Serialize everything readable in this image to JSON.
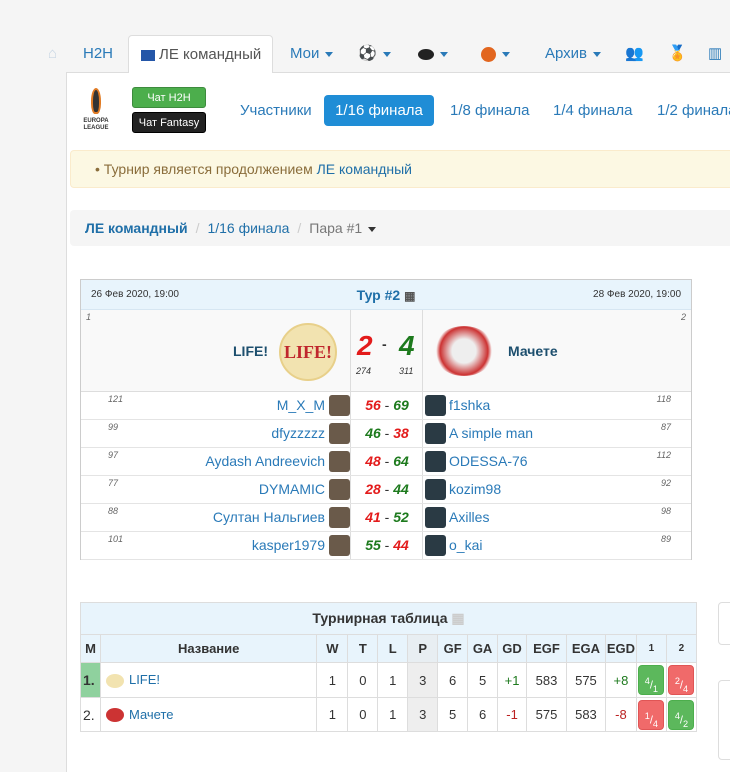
{
  "nav": {
    "tabs": [
      "H2H",
      "ЛЕ командный",
      "Мои",
      "Архив"
    ],
    "active": "ЛЕ командный"
  },
  "chat": {
    "h2h": "Чат H2H",
    "fantasy": "Чат Fantasy"
  },
  "logo_text": "EUROPA LEAGUE",
  "stages": [
    "Участники",
    "1/16 финала",
    "1/8 финала",
    "1/4 финала",
    "1/2 финала"
  ],
  "alert": {
    "text": "Турнир является продолжением",
    "link": "ЛЕ командный"
  },
  "breadcrumb": {
    "items": [
      "ЛЕ командный",
      "1/16 финала"
    ],
    "current": "Пара #1"
  },
  "match": {
    "date_left": "26 Фев 2020, 19:00",
    "round": "Тур #2",
    "date_right": "28 Фев 2020, 19:00",
    "home": {
      "seed": "1",
      "name": "LIFE!",
      "logo": "LIFE!",
      "goals": "2",
      "points": "274"
    },
    "away": {
      "seed": "2",
      "name": "Мачете",
      "goals": "4",
      "points": "311"
    },
    "dash": "-",
    "players": [
      {
        "hs": "121",
        "h": "M_X_M",
        "hp": "56",
        "ap": "69",
        "a": "f1shka",
        "as": "118",
        "hw": false
      },
      {
        "hs": "99",
        "h": "dfyzzzzz",
        "hp": "46",
        "ap": "38",
        "a": "A simple man",
        "as": "87",
        "hw": true
      },
      {
        "hs": "97",
        "h": "Aydash Andreevich",
        "hp": "48",
        "ap": "64",
        "a": "ODESSA-76",
        "as": "112",
        "hw": false
      },
      {
        "hs": "77",
        "h": "DYMAMIC",
        "hp": "28",
        "ap": "44",
        "a": "kozim98",
        "as": "92",
        "hw": false
      },
      {
        "hs": "88",
        "h": "Султан Нальгиев",
        "hp": "41",
        "ap": "52",
        "a": "Axilles",
        "as": "98",
        "hw": false
      },
      {
        "hs": "101",
        "h": "kasper1979",
        "hp": "55",
        "ap": "44",
        "a": "o_kai",
        "as": "89",
        "hw": true
      }
    ]
  },
  "standings": {
    "title": "Турнирная таблица",
    "headers": [
      "М",
      "Название",
      "W",
      "T",
      "L",
      "P",
      "GF",
      "GA",
      "GD",
      "EGF",
      "EGA",
      "EGD",
      "1",
      "2"
    ],
    "rows": [
      {
        "pos": "1.",
        "name": "LIFE!",
        "w": "1",
        "t": "0",
        "l": "1",
        "p": "3",
        "gf": "6",
        "ga": "5",
        "gd": "+1",
        "egf": "583",
        "ega": "575",
        "egd": "+8",
        "r1": [
          "4",
          "1"
        ],
        "r2": [
          "2",
          "4"
        ]
      },
      {
        "pos": "2.",
        "name": "Мачете",
        "w": "1",
        "t": "0",
        "l": "1",
        "p": "3",
        "gf": "5",
        "ga": "6",
        "gd": "-1",
        "egf": "575",
        "ega": "583",
        "egd": "-8",
        "r1": [
          "1",
          "4"
        ],
        "r2": [
          "4",
          "2"
        ]
      }
    ]
  },
  "colors": {
    "accent": "#1f8dd6",
    "win": "#5cb85c",
    "loss": "#f06a6a"
  }
}
